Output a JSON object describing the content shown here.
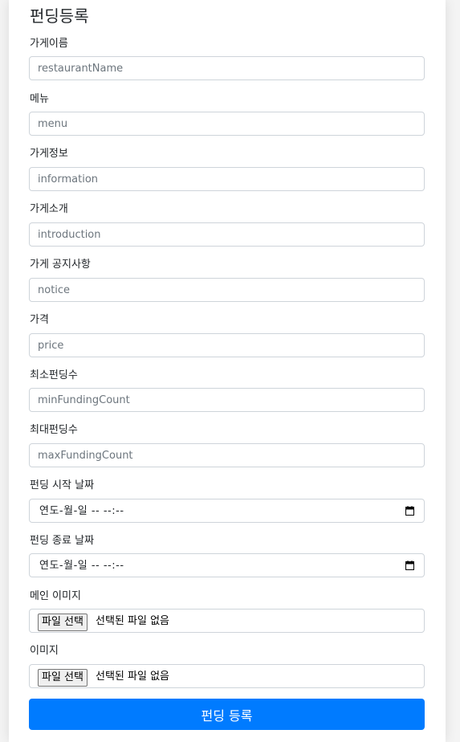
{
  "form": {
    "title": "펀딩등록",
    "fields": [
      {
        "label": "가게이름",
        "placeholder": "restaurantName"
      },
      {
        "label": "메뉴",
        "placeholder": "menu"
      },
      {
        "label": "가게정보",
        "placeholder": "information"
      },
      {
        "label": "가게소개",
        "placeholder": "introduction"
      },
      {
        "label": "가게 공지사항",
        "placeholder": "notice"
      },
      {
        "label": "가격",
        "placeholder": "price"
      },
      {
        "label": "최소펀딩수",
        "placeholder": "minFundingCount"
      },
      {
        "label": "최대펀딩수",
        "placeholder": "maxFundingCount"
      }
    ],
    "start_date": {
      "label": "펀딩 시작 날짜",
      "value": "연도-월-일 -- --:--"
    },
    "end_date": {
      "label": "펀딩 종료 날짜",
      "value": "연도-월-일 -- --:--"
    },
    "main_image": {
      "label": "메인 이미지",
      "button": "파일 선택",
      "status": "선택된 파일 없음"
    },
    "image": {
      "label": "이미지",
      "button": "파일 선택",
      "status": "선택된 파일 없음"
    },
    "submit_label": "펀딩 등록"
  },
  "colors": {
    "primary": "#007bff",
    "border": "#ced4da"
  }
}
